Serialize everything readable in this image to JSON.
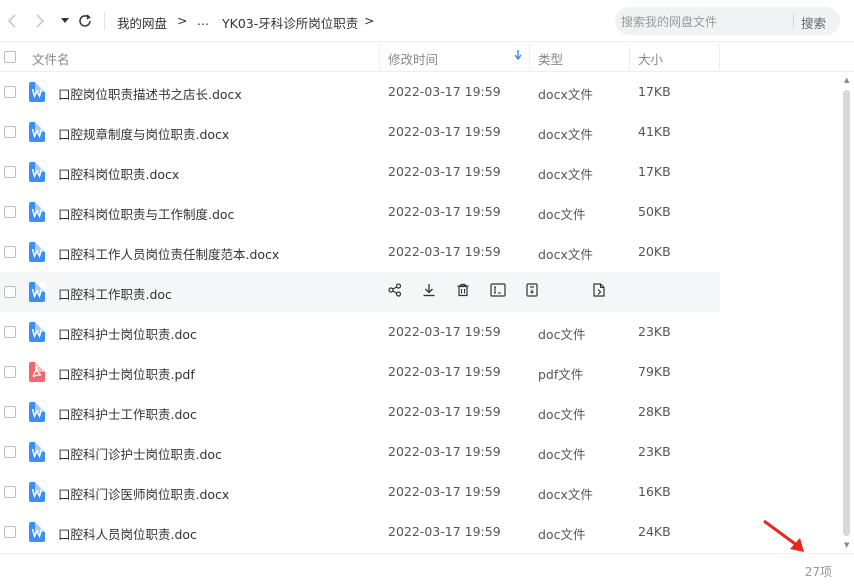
{
  "toolbar": {
    "back_icon": "chevron-left-icon",
    "forward_icon": "chevron-right-icon",
    "dropdown_icon": "caret-down-icon",
    "refresh_icon": "refresh-icon",
    "breadcrumb": {
      "root": "我的网盘",
      "ellipsis": "...",
      "current": "YK03-牙科诊所岗位职责",
      "sep": ">"
    },
    "search": {
      "placeholder": "搜索我的网盘文件",
      "button": "搜索"
    }
  },
  "table": {
    "columns": {
      "name": "文件名",
      "modified": "修改时间",
      "type": "类型",
      "size": "大小"
    },
    "sort_icon": "sort-down-arrow-icon",
    "rows": [
      {
        "name": "口腔岗位职责描述书之店长.docx",
        "date": "2022-03-17 19:59",
        "type": "docx文件",
        "size": "17KB",
        "icon": "word-file-icon"
      },
      {
        "name": "口腔规章制度与岗位职责.docx",
        "date": "2022-03-17 19:59",
        "type": "docx文件",
        "size": "41KB",
        "icon": "word-file-icon"
      },
      {
        "name": "口腔科岗位职责.docx",
        "date": "2022-03-17 19:59",
        "type": "docx文件",
        "size": "17KB",
        "icon": "word-file-icon"
      },
      {
        "name": "口腔科岗位职责与工作制度.doc",
        "date": "2022-03-17 19:59",
        "type": "doc文件",
        "size": "50KB",
        "icon": "word-file-icon"
      },
      {
        "name": "口腔科工作人员岗位责任制度范本.docx",
        "date": "2022-03-17 19:59",
        "type": "docx文件",
        "size": "20KB",
        "icon": "word-file-icon"
      },
      {
        "name": "口腔科工作职责.doc",
        "date": "",
        "type": "",
        "size": "",
        "icon": "word-file-icon",
        "hover": true
      },
      {
        "name": "口腔科护士岗位职责.doc",
        "date": "2022-03-17 19:59",
        "type": "doc文件",
        "size": "23KB",
        "icon": "word-file-icon"
      },
      {
        "name": "口腔科护士岗位职责.pdf",
        "date": "2022-03-17 19:59",
        "type": "pdf文件",
        "size": "79KB",
        "icon": "pdf-file-icon"
      },
      {
        "name": "口腔科护士工作职责.doc",
        "date": "2022-03-17 19:59",
        "type": "doc文件",
        "size": "28KB",
        "icon": "word-file-icon"
      },
      {
        "name": "口腔科门诊护士岗位职责.doc",
        "date": "2022-03-17 19:59",
        "type": "doc文件",
        "size": "23KB",
        "icon": "word-file-icon"
      },
      {
        "name": "口腔科门诊医师岗位职责.docx",
        "date": "2022-03-17 19:59",
        "type": "docx文件",
        "size": "16KB",
        "icon": "word-file-icon"
      },
      {
        "name": "口腔科人员岗位职责.doc",
        "date": "2022-03-17 19:59",
        "type": "doc文件",
        "size": "24KB",
        "icon": "word-file-icon"
      }
    ],
    "hover_actions": [
      "share-icon",
      "download-icon",
      "delete-icon",
      "rename-icon",
      "move-icon",
      "more-icon"
    ]
  },
  "footer": {
    "count": "27项"
  },
  "colors": {
    "accent": "#2b8bf4",
    "word": "#3d8ef3",
    "pdf": "#f0686c",
    "annotation": "#e8271d"
  }
}
